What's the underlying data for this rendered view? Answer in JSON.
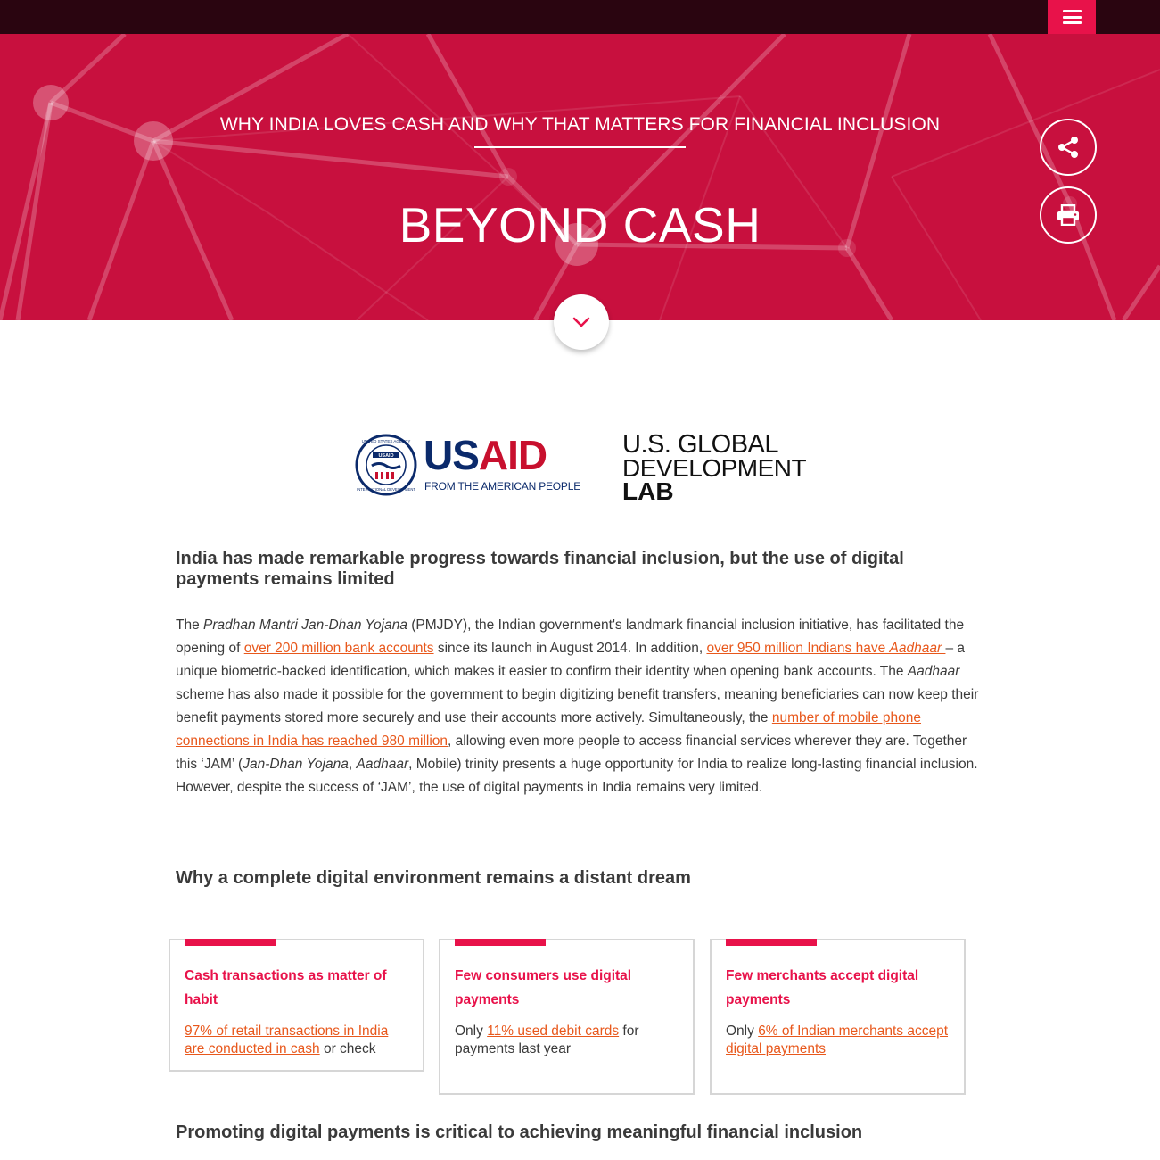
{
  "header": {
    "menu_icon": "hamburger-menu-icon",
    "accent_color": "#e8124a",
    "topbar_color": "#2a0510"
  },
  "hero": {
    "kicker": "WHY INDIA LOVES CASH AND WHY THAT MATTERS FOR FINANCIAL INCLUSION",
    "title": "BEYOND CASH",
    "background_color": "#c8103e",
    "share_icon": "share-icon",
    "print_icon": "print-icon",
    "scroll_icon": "chevron-down-icon"
  },
  "logos": {
    "usaid_us": "US",
    "usaid_aid": "AID",
    "usaid_tagline": "FROM THE AMERICAN PEOPLE",
    "seal_top_text": "UNITED STATES AGENCY",
    "seal_bottom_text": "INTERNATIONAL DEVELOPMENT",
    "seal_center": "USAID",
    "lab_line1": "U.S. GLOBAL",
    "lab_line2": "DEVELOPMENT",
    "lab_line3": "LAB"
  },
  "intro": {
    "heading": "India has made remarkable progress towards financial inclusion, but the use of digital payments remains limited",
    "p_1": "The ",
    "p_2": "Pradhan Mantri Jan-Dhan Yojana",
    "p_3": " (PMJDY), the Indian government's landmark financial inclusion initiative, has facilitated the opening of ",
    "p_link1": "over 200 million bank accounts",
    "p_4": " since its launch in August 2014. In addition, ",
    "p_link2a": "over 950 million Indians have ",
    "p_link2b": "Aadhaar",
    "p_link2c": " ",
    "p_5": "– a unique biometric-backed identification, which makes it easier to confirm their identity when opening bank accounts. The ",
    "p_6": "Aadhaar",
    "p_7": " scheme has also made it possible for the government to begin digitizing benefit transfers, meaning beneficiaries can now keep their benefit payments stored more securely and use their accounts more actively. Simultaneously, the ",
    "p_link3": "number of mobile phone connections in India has reached 980 million",
    "p_8": ", allowing even more people to access financial services wherever they are. Together this ‘JAM’ (",
    "p_9": "Jan-Dhan Yojana",
    "p_10": ", ",
    "p_11": "Aadhaar",
    "p_12": ", Mobile) trinity presents a huge opportunity for India to realize long-lasting financial inclusion. However, despite the success of ‘JAM’, the use of digital payments in India remains very limited.",
    "link_color": "#e8581c"
  },
  "why": {
    "heading": "Why a complete digital environment remains a distant dream",
    "cards": [
      {
        "title": "Cash transactions as matter of habit",
        "pre": "",
        "link": "97% of retail transactions in India are conducted in cash",
        "post": " or check"
      },
      {
        "title": "Few consumers use digital payments",
        "pre": "Only ",
        "link": "11% used debit cards",
        "post": " for payments last year"
      },
      {
        "title": "Few merchants accept digital payments",
        "pre": "Only ",
        "link": "6% of Indian merchants accept digital payments",
        "post": ""
      }
    ]
  },
  "promo": {
    "heading": "Promoting digital payments is critical to achieving meaningful financial inclusion"
  }
}
